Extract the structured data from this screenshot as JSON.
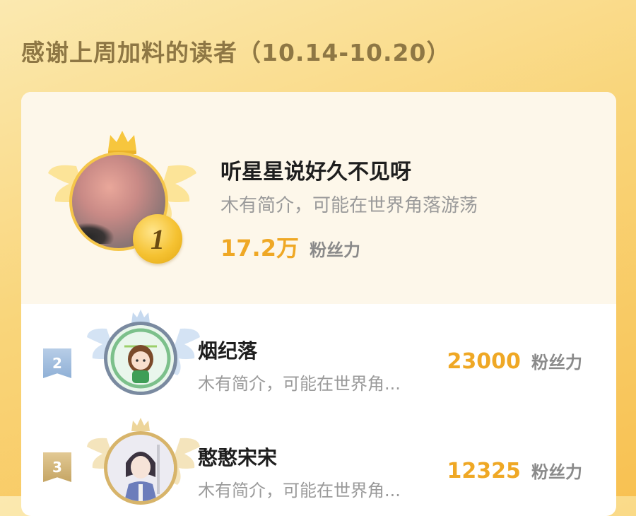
{
  "title": "感谢上周加料的读者（10.14-10.20）",
  "fans_unit": "粉丝力",
  "first": {
    "rank": "1",
    "name": "听星星说好久不见呀",
    "bio": "木有简介，可能在世界角落游荡",
    "fans": "17.2万"
  },
  "rows": [
    {
      "rank": "2",
      "name": "烟纪落",
      "bio": "木有简介，可能在世界角...",
      "fans": "23000"
    },
    {
      "rank": "3",
      "name": "憨憨宋宋",
      "bio": "木有简介，可能在世界角...",
      "fans": "12325"
    }
  ],
  "colors": {
    "accent": "#efa825",
    "gold": "#f5c64a",
    "silver": "#9fbde0",
    "bronze": "#d2b478"
  },
  "icons": {
    "crown": "crown-icon",
    "wings": "wings-icon",
    "medal": "medal-icon",
    "rank_badge": "ribbon-badge-icon"
  }
}
